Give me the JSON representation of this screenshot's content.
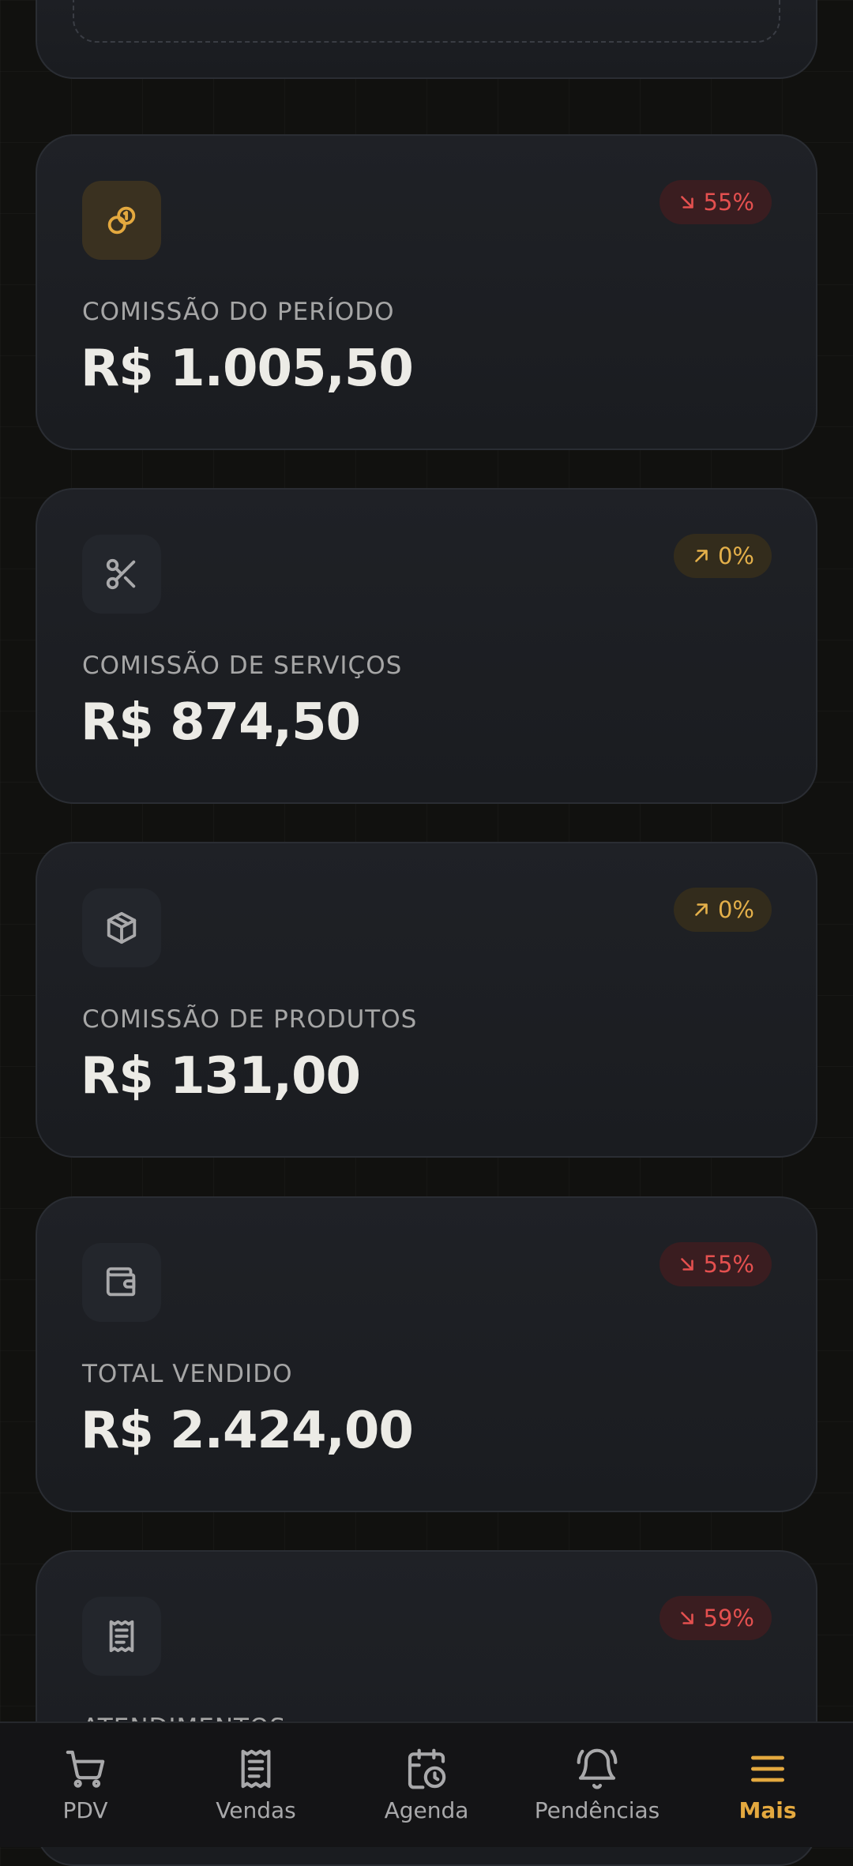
{
  "cards": [
    {
      "label": "COMISSÃO DO PERÍODO",
      "value": "R$ 1.005,50",
      "badge": "55%",
      "trend": "down",
      "icon": "coins-icon"
    },
    {
      "label": "COMISSÃO DE SERVIÇOS",
      "value": "R$ 874,50",
      "badge": "0%",
      "trend": "up",
      "icon": "scissors-icon"
    },
    {
      "label": "COMISSÃO DE PRODUTOS",
      "value": "R$ 131,00",
      "badge": "0%",
      "trend": "up",
      "icon": "box-icon"
    },
    {
      "label": "TOTAL VENDIDO",
      "value": "R$ 2.424,00",
      "badge": "55%",
      "trend": "down",
      "icon": "wallet-icon"
    },
    {
      "label": "ATENDIMENTOS",
      "value": "",
      "badge": "59%",
      "trend": "down",
      "icon": "receipt-icon"
    }
  ],
  "nav": {
    "items": [
      {
        "label": "PDV",
        "icon": "cart-icon"
      },
      {
        "label": "Vendas",
        "icon": "receipt-icon"
      },
      {
        "label": "Agenda",
        "icon": "calendar-clock-icon"
      },
      {
        "label": "Pendências",
        "icon": "bell-icon"
      },
      {
        "label": "Mais",
        "icon": "menu-icon",
        "active": true
      }
    ]
  },
  "colors": {
    "accent": "#e4a93f",
    "negative": "#e4504f",
    "background": "#11110f",
    "card": "#1e2025"
  }
}
